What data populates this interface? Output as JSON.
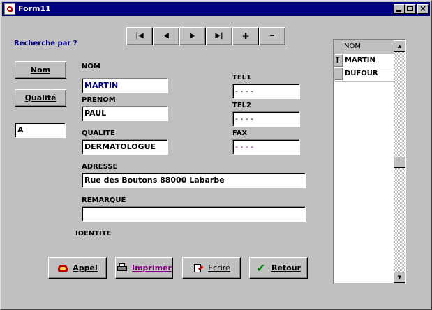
{
  "window": {
    "title": "Form11"
  },
  "labels": {
    "search_by": "Recherche par ?",
    "nom": "NOM",
    "prenom": "PRENOM",
    "qualite": "QUALITE",
    "adresse": "ADRESSE",
    "remarque": "REMARQUE",
    "identite": "IDENTITE",
    "tel1": "TEL1",
    "tel2": "TEL2",
    "fax": "FAX"
  },
  "search_buttons": {
    "nom": "Nom",
    "qualite": "Qualité"
  },
  "search_input": {
    "value": "A"
  },
  "navigator": {
    "first": "|◀",
    "prior": "◀",
    "next": "▶",
    "last": "▶|",
    "insert": "✚",
    "delete": "━"
  },
  "fields": {
    "nom": "MARTIN",
    "prenom": "PAUL",
    "qualite": "DERMATOLOGUE",
    "adresse": "Rue des Boutons 88000 Labarbe",
    "remarque": "",
    "tel1": " - - - -",
    "tel2": " - - - -",
    "fax": " - - - -"
  },
  "grid": {
    "header": "NOM",
    "rows": [
      "MARTIN",
      "DUFOUR"
    ],
    "scroll_up": "▲",
    "scroll_down": "▼",
    "cursor": "I"
  },
  "actions": {
    "appel": "Appel",
    "imprimer": "Imprimer",
    "ecrire": "Ecrire",
    "retour": "Retour"
  },
  "colors": {
    "title_bar": "#000080",
    "nom_text": "#000080",
    "fax_text": "#800080",
    "imprimer_text": "#800080"
  }
}
